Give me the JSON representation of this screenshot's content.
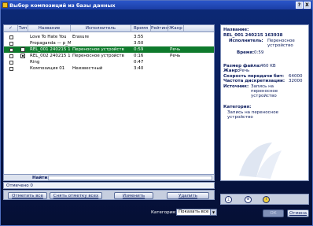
{
  "window": {
    "title": "Выбор композиций из базы данных",
    "help_label": "?",
    "close_label": "X"
  },
  "columns": {
    "check": "✓",
    "type": "Тип",
    "name": "Название",
    "artist": "Исполнитель",
    "time": "Время",
    "rating": "Рейтинг",
    "genre": "Жанр"
  },
  "rows": [
    {
      "name": "Love To Hate You",
      "artist": "Erasure",
      "time": "3:55",
      "genre": "",
      "selected": false
    },
    {
      "name": "Propaganda — p_Mach",
      "artist": "",
      "time": "3:50",
      "genre": "",
      "selected": false
    },
    {
      "name": "REL_001 240215 1639",
      "artist": "Переносное устройств",
      "time": "0:59",
      "genre": "Речь",
      "selected": true
    },
    {
      "name": "REL_002 240215 1719",
      "artist": "Переносное устройств",
      "time": "0:16",
      "genre": "Речь",
      "selected": false
    },
    {
      "name": "Ring",
      "artist": "",
      "time": "0:47",
      "genre": "",
      "selected": false
    },
    {
      "name": "Композиция 01",
      "artist": "Неизвестный",
      "time": "3:40",
      "genre": "",
      "selected": false
    }
  ],
  "search": {
    "label": "Найти:"
  },
  "status": {
    "text": "Отмечено 0"
  },
  "buttons": {
    "mark_all": "Отметить все",
    "unmark_all": "Снять отметку всех",
    "edit": "Изменить",
    "delete": "Удалить"
  },
  "info": {
    "title_label": "Название:",
    "title_value": "REL_001 240215 163938",
    "artist_label": "Исполнитель:",
    "artist_value_1": "Переносное",
    "artist_value_2": "устройство",
    "time_label": "Время:",
    "time_value": "0:59",
    "size_label": "Размер файла:",
    "size_value": "460 KB",
    "genre_label": "Жанр:",
    "genre_value": "Речь",
    "bitrate_label": "Скорость передачи бит:",
    "bitrate_value": "64000",
    "sample_label": "Частота дискретизации:",
    "sample_value": "32000",
    "source_label": "Источник:",
    "source_value_1": "Запись на",
    "source_value_2": "переносное",
    "source_value_3": "устройство",
    "category_label": "Категория:",
    "category_value_1": "Запись на переносное",
    "category_value_2": "устройство"
  },
  "category": {
    "label": "Категория:",
    "selected": "Показать все"
  },
  "dialog": {
    "ok": "ОК",
    "cancel": "Отмена"
  },
  "colors": {
    "selected_row": "#0e7a2c",
    "background": "#0a1a50"
  }
}
